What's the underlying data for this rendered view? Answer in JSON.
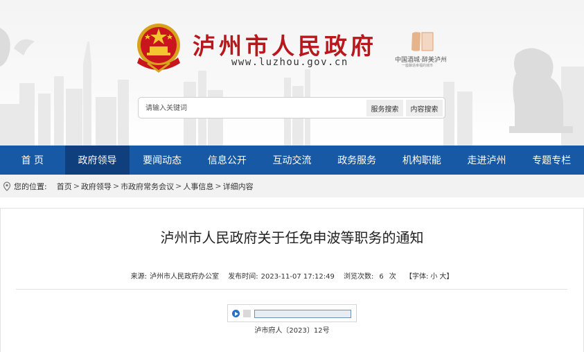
{
  "header": {
    "title": "泸州市人民政府",
    "url": "www.luzhou.gov.cn",
    "seal_text": "中国酒城",
    "slogan": "中国酒城·醉美泸州",
    "slogan_sub": "一座酿造幸福的城市"
  },
  "search": {
    "placeholder": "请输入关键词",
    "service_label": "服务搜索",
    "content_label": "内容搜索"
  },
  "nav": {
    "items": [
      {
        "label": "首 页"
      },
      {
        "label": "政府领导"
      },
      {
        "label": "要闻动态"
      },
      {
        "label": "信息公开"
      },
      {
        "label": "互动交流"
      },
      {
        "label": "政务服务"
      },
      {
        "label": "机构职能"
      },
      {
        "label": "走进泸州"
      },
      {
        "label": "专题专栏"
      }
    ],
    "active_index": 1
  },
  "breadcrumb": {
    "prefix": "您的位置:",
    "items": [
      "首页",
      "政府领导",
      "市政府常务会议",
      "人事信息",
      "详细内容"
    ],
    "separator": ">"
  },
  "article": {
    "title": "泸州市人民政府关于任免申波等职务的通知",
    "source_label": "来源:",
    "source": "泸州市人民政府办公室",
    "time_label": "发布时间:",
    "time": "2023-11-07 17:12:49",
    "views_label": "浏览次数:",
    "views": "6",
    "views_unit": "次",
    "font_label": "【字体:",
    "font_small": "小",
    "font_large": "大】",
    "doc_number": "泸市府人〔2023〕12号"
  },
  "colors": {
    "nav_bg": "#1859a5",
    "nav_active": "#0f3f7c",
    "title_red": "#b8171c"
  }
}
